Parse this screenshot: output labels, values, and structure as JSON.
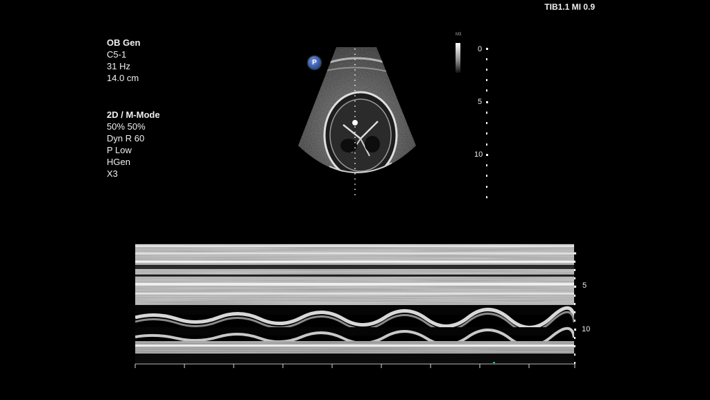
{
  "header": {
    "tib_mi": "TIB1.1 MI 0.9"
  },
  "mode_params": {
    "preset": "OB Gen",
    "transducer": "C5-1",
    "frame_rate": "31 Hz",
    "depth": "14.0 cm"
  },
  "imaging_params": {
    "mode": "2D / M-Mode",
    "gain": "50%  50%",
    "dyn_range": "Dyn R 60",
    "power": "P Low",
    "harmonic": "HGen",
    "zoom": "X3"
  },
  "probe_badge": {
    "label": "P",
    "color": "#3a5bb0"
  },
  "grayscale": {
    "label": "M3"
  },
  "depth_scale_2d": {
    "labels": [
      "0",
      "5",
      "10"
    ]
  },
  "mmode_scale": {
    "labels": [
      "5",
      "10"
    ]
  },
  "colors": {
    "marker_green": "#19b36b",
    "marker_teal": "#1fb8a8",
    "accent_yellow": "#c9a640"
  }
}
